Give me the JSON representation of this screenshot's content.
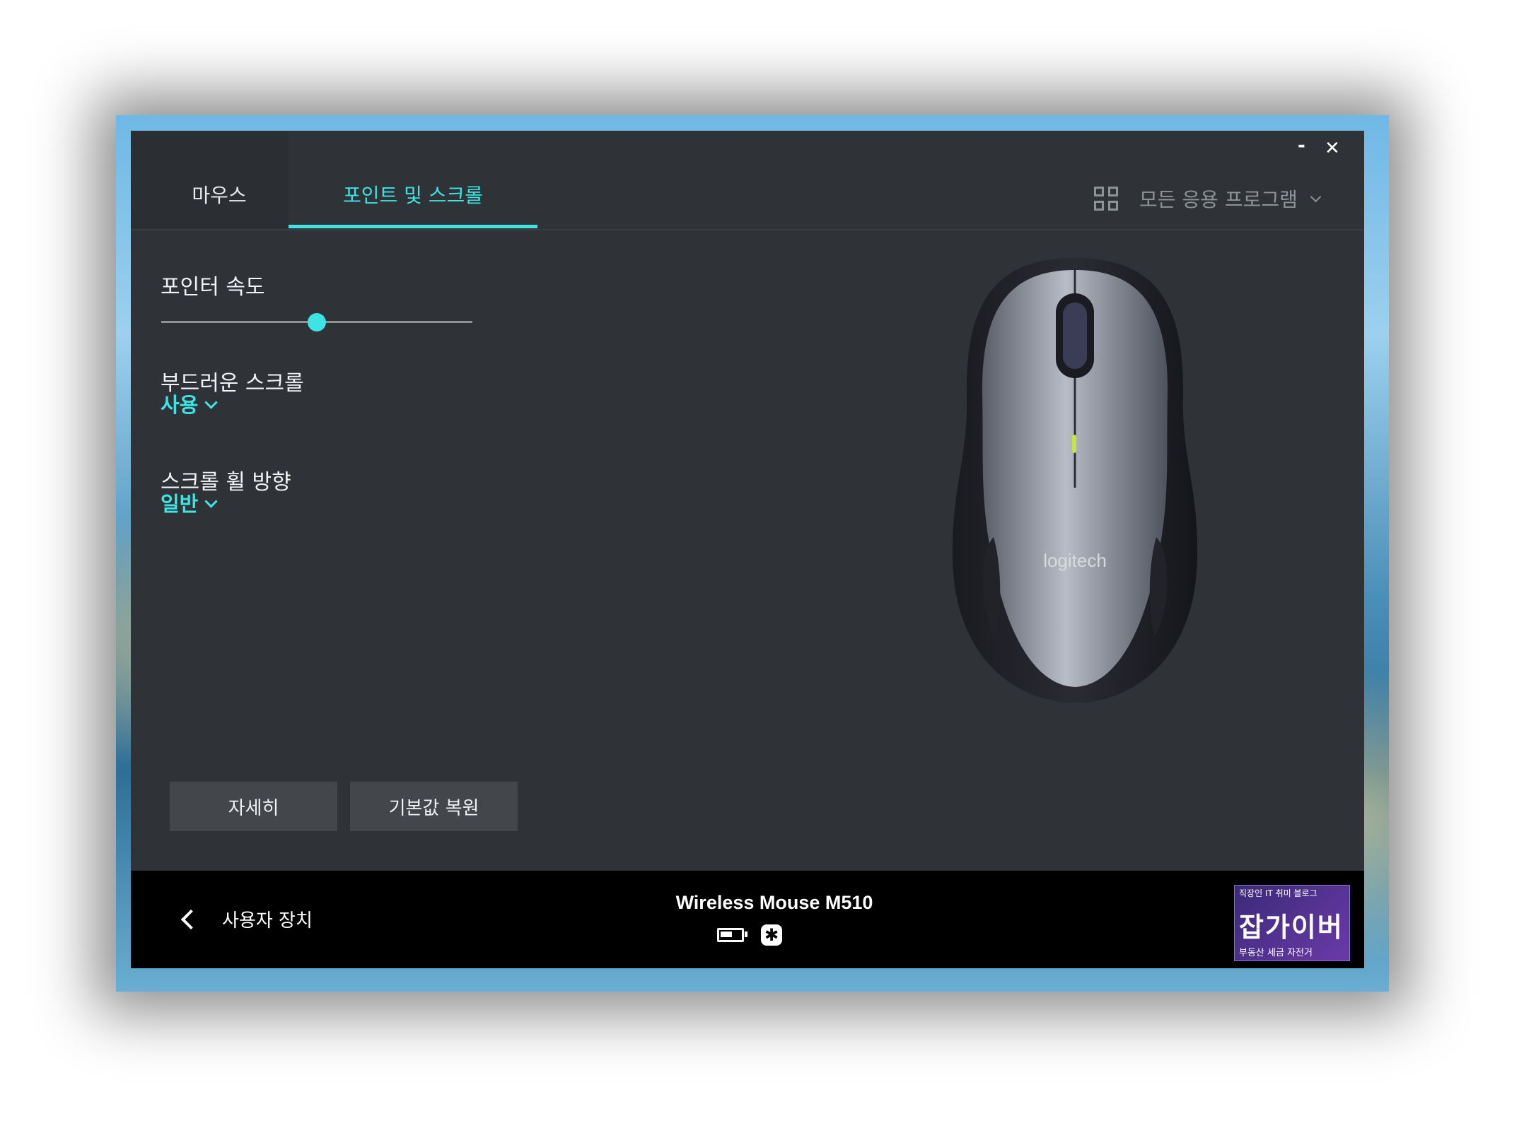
{
  "window": {
    "minimize_label": "-",
    "close_label": "✕"
  },
  "tabs": [
    {
      "label": "마우스",
      "active": false
    },
    {
      "label": "포인트 및 스크롤",
      "active": true
    }
  ],
  "app_selector": {
    "label": "모든 응용 프로그램",
    "icon": "grid-icon"
  },
  "settings": {
    "pointer_speed": {
      "label": "포인터 속도",
      "value_fraction": 0.5
    },
    "smooth_scroll": {
      "label": "부드러운 스크롤",
      "value": "사용"
    },
    "scroll_direction": {
      "label": "스크롤 휠 방향",
      "value": "일반"
    }
  },
  "buttons": {
    "details": "자세히",
    "restore_defaults": "기본값 복원"
  },
  "mouse_image": {
    "brand": "logitech"
  },
  "footer": {
    "back_label": "사용자 장치",
    "device_name": "Wireless Mouse M510",
    "battery_icon": "battery-icon",
    "receiver_icon": "unifying-receiver-icon"
  },
  "watermark": {
    "top_text": "직장인 IT 취미 블로그",
    "big_text": "잡가이버",
    "bottom_text": "부동산 세금 자전거"
  },
  "colors": {
    "accent": "#3ee3e3",
    "panel": "#2f3236",
    "footer": "#000000"
  }
}
